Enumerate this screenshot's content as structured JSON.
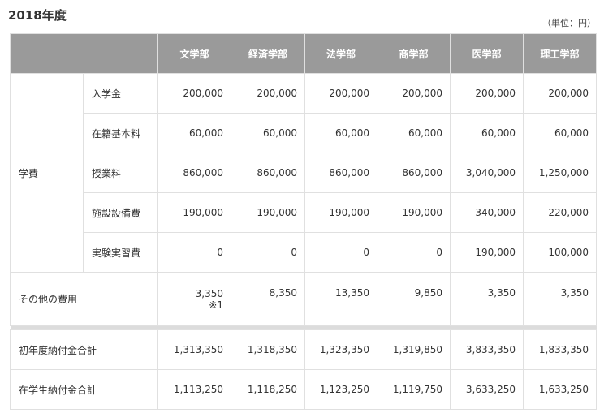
{
  "title": "2018年度",
  "unit": "（単位：円）",
  "columns": [
    "文学部",
    "経済学部",
    "法学部",
    "商学部",
    "医学部",
    "理工学部"
  ],
  "group_label": "学費",
  "group_rows": [
    {
      "label": "入学金",
      "values": [
        "200,000",
        "200,000",
        "200,000",
        "200,000",
        "200,000",
        "200,000"
      ]
    },
    {
      "label": "在籍基本料",
      "values": [
        "60,000",
        "60,000",
        "60,000",
        "60,000",
        "60,000",
        "60,000"
      ]
    },
    {
      "label": "授業料",
      "values": [
        "860,000",
        "860,000",
        "860,000",
        "860,000",
        "3,040,000",
        "1,250,000"
      ]
    },
    {
      "label": "施設設備費",
      "values": [
        "190,000",
        "190,000",
        "190,000",
        "190,000",
        "340,000",
        "220,000"
      ]
    },
    {
      "label": "実験実習費",
      "values": [
        "0",
        "0",
        "0",
        "0",
        "190,000",
        "100,000"
      ]
    }
  ],
  "other_row": {
    "label": "その他の費用",
    "values": [
      "3,350",
      "8,350",
      "13,350",
      "9,850",
      "3,350",
      "3,350"
    ],
    "note": "※1"
  },
  "total_rows": [
    {
      "label": "初年度納付金合計",
      "values": [
        "1,313,350",
        "1,318,350",
        "1,323,350",
        "1,319,850",
        "3,833,350",
        "1,833,350"
      ]
    },
    {
      "label": "在学生納付金合計",
      "values": [
        "1,113,250",
        "1,118,250",
        "1,123,250",
        "1,119,750",
        "3,633,250",
        "1,633,250"
      ]
    }
  ]
}
